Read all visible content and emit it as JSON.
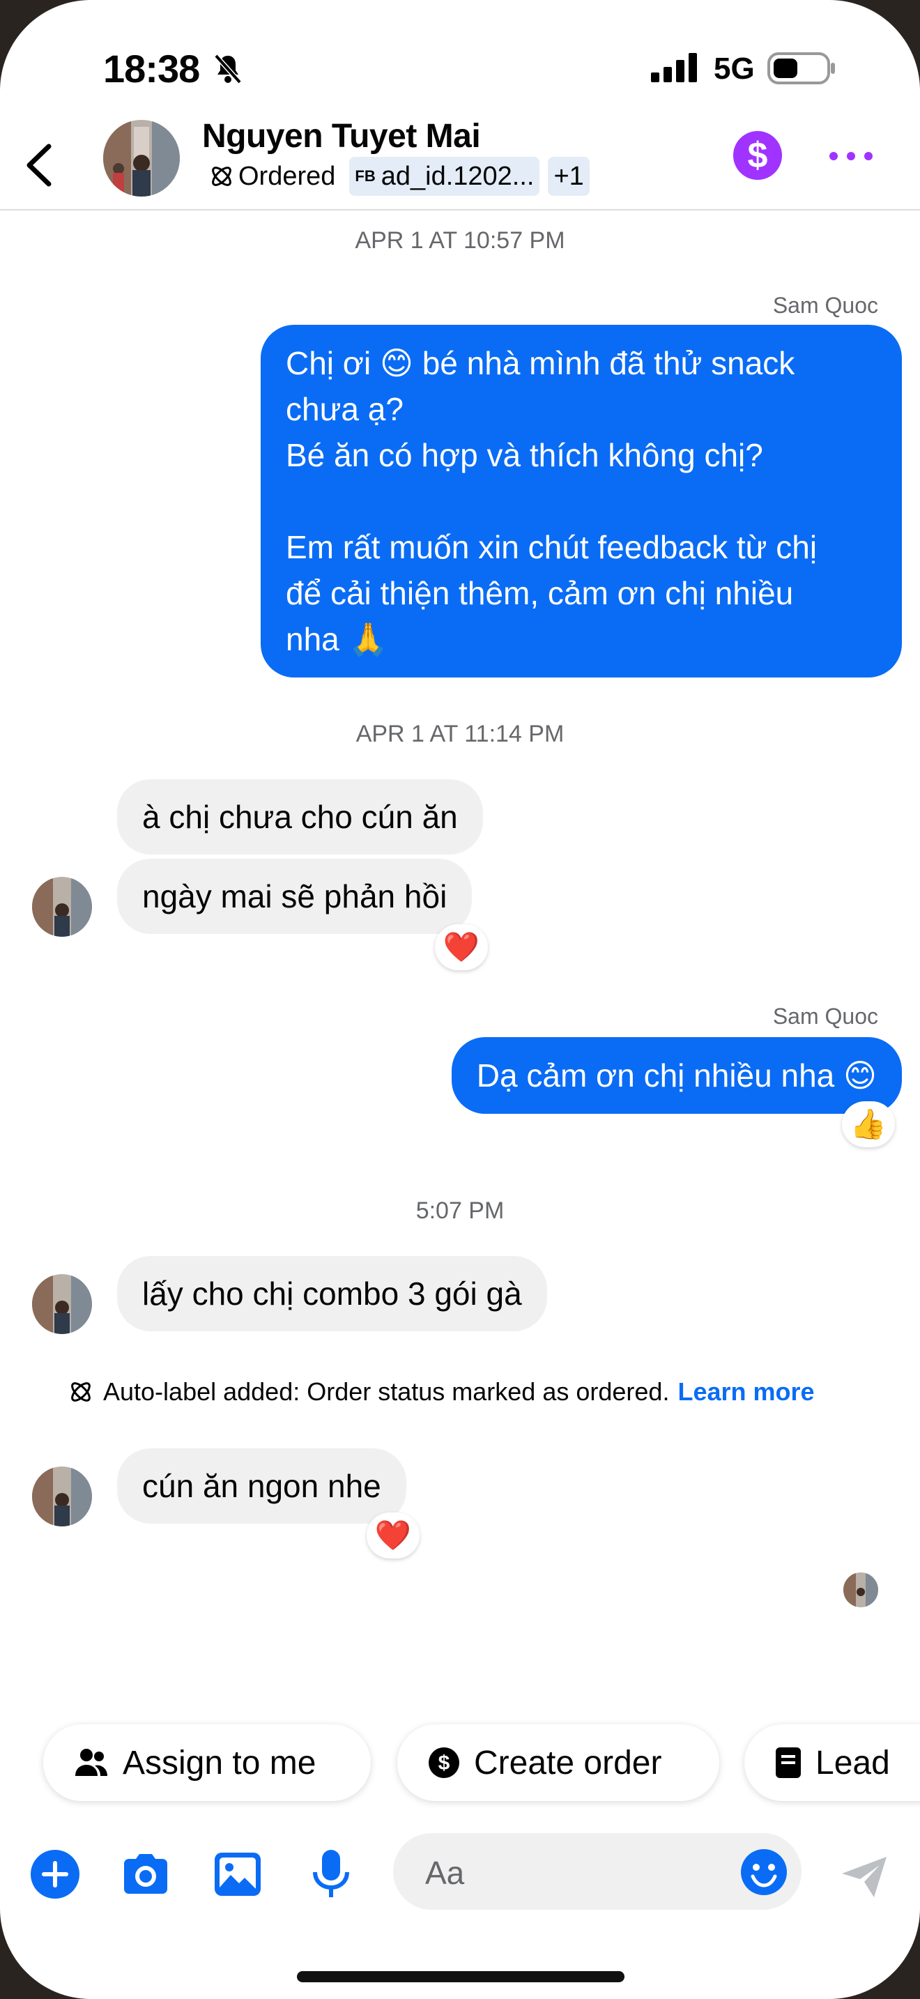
{
  "status_bar": {
    "time": "18:38",
    "network": "5G"
  },
  "header": {
    "contact_name": "Nguyen Tuyet Mai",
    "label_ordered": "Ordered",
    "label_ad_prefix": "FB",
    "label_ad": "ad_id.1202...",
    "label_more": "+1"
  },
  "chat": {
    "ts1": "APR 1 AT 10:57 PM",
    "sender1": "Sam Quoc",
    "msg1_l1": "Chị ơi 😊 bé nhà mình đã thử snack",
    "msg1_l2": "chưa ạ?",
    "msg1_l3": "Bé ăn có hợp và thích không chị?",
    "msg1_l4": "Em rất muốn xin chút feedback từ chị",
    "msg1_l5": "để cải thiện thêm, cảm ơn chị nhiều",
    "msg1_l6": "nha 🙏",
    "ts2": "APR 1 AT 11:14 PM",
    "in1": "à chị chưa cho cún ăn",
    "in2": "ngày mai sẽ phản hồi",
    "react_in2": "❤️",
    "sender2": "Sam Quoc",
    "msg2": "Dạ cảm ơn chị nhiều nha 😊",
    "react_msg2": "👍",
    "ts3": "5:07 PM",
    "in3": "lấy cho chị combo 3 gói gà",
    "system_text": "Auto-label added: Order status marked as ordered.",
    "system_link": "Learn more",
    "in4": "cún ăn ngon nhe",
    "react_in4": "❤️"
  },
  "quick_actions": {
    "assign": "Assign to me",
    "create_order": "Create order",
    "lead": "Lead"
  },
  "composer": {
    "placeholder": "Aa"
  },
  "colors": {
    "accent": "#0a6cf5",
    "payment": "#a033ff",
    "incoming_bg": "#f0f0f0"
  }
}
